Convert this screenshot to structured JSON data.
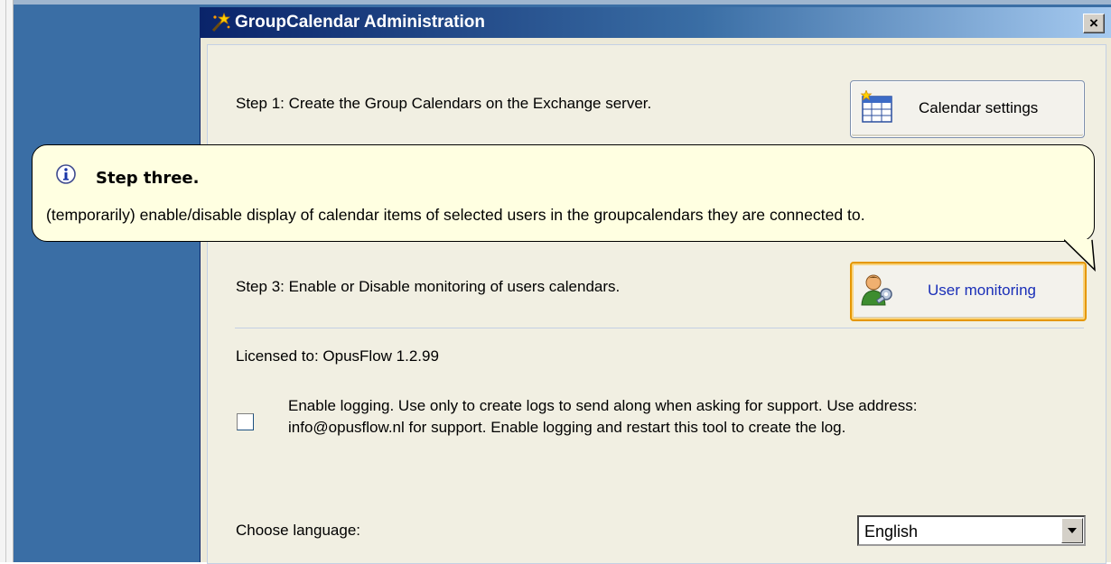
{
  "window": {
    "title": "GroupCalendar Administration",
    "close_label": "×"
  },
  "step1": {
    "text": "Step 1: Create the Group Calendars on the Exchange server.",
    "button_label": "Calendar settings"
  },
  "step3": {
    "text": "Step 3: Enable or Disable monitoring of users calendars.",
    "button_label": "User monitoring"
  },
  "license_text": "Licensed to: OpusFlow 1.2.99",
  "logging": {
    "checked": false,
    "line1": "Enable logging. Use only to create logs to send along when asking for support. Use address:",
    "line2": "info@opusflow.nl for support. Enable logging and restart this tool to create the log."
  },
  "language": {
    "label": "Choose language:",
    "selected": "English"
  },
  "tooltip": {
    "title": "Step three.",
    "body": "(temporarily) enable/disable display of calendar items of selected users in the groupcalendars they are connected to."
  },
  "colors": {
    "desktop": "#3a6ea5",
    "tooltip_bg": "#ffffe1",
    "active_button_border": "#e59700",
    "link_text": "#1a2fb8"
  },
  "icons": {
    "title": "magic-wand-icon",
    "calendar_settings": "calendar-grid-icon",
    "user_monitoring": "user-key-icon",
    "tooltip": "info-icon",
    "select_arrow": "dropdown-arrow-icon"
  }
}
